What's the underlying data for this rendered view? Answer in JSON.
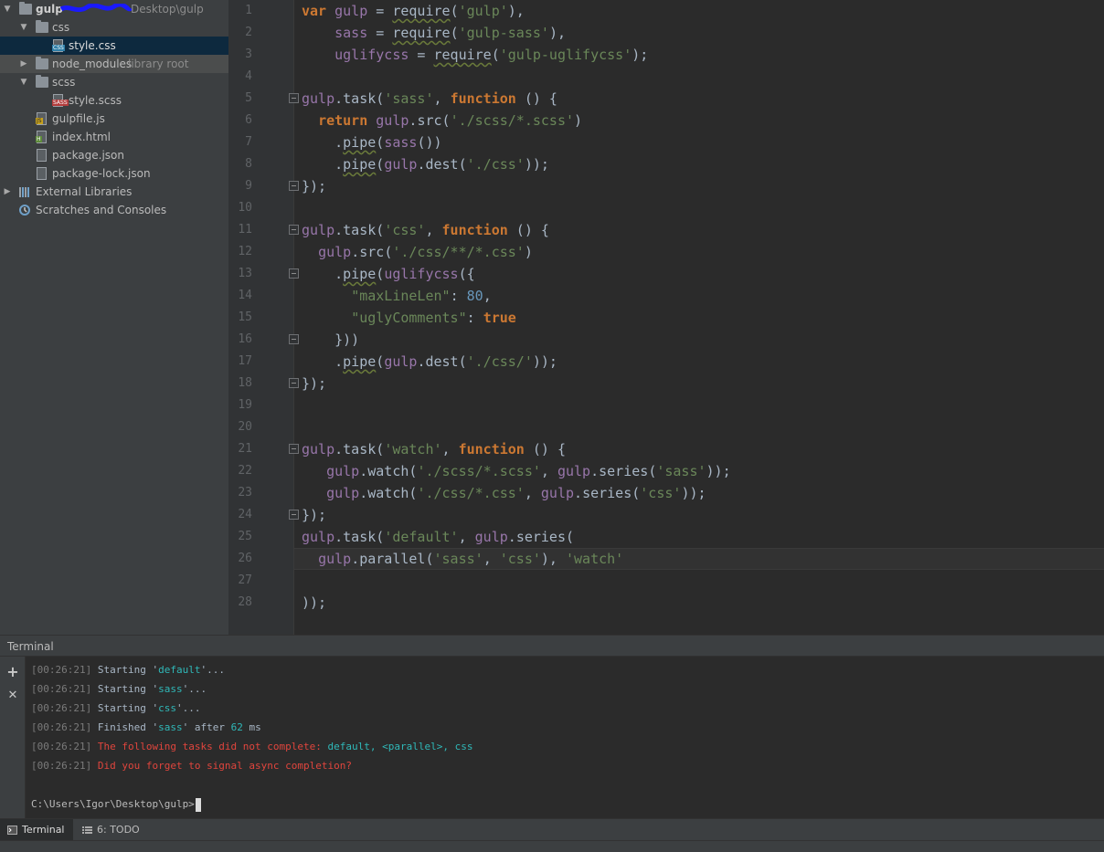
{
  "project_tree": {
    "root": {
      "name": "gulp",
      "path": "Desktop\\gulp"
    },
    "items": [
      {
        "label": "css"
      },
      {
        "label": "style.css"
      },
      {
        "label": "node_modules",
        "suffix": "library root"
      },
      {
        "label": "scss"
      },
      {
        "label": "style.scss"
      },
      {
        "label": "gulpfile.js"
      },
      {
        "label": "index.html"
      },
      {
        "label": "package.json"
      },
      {
        "label": "package-lock.json"
      },
      {
        "label": "External Libraries"
      },
      {
        "label": "Scratches and Consoles"
      }
    ]
  },
  "editor": {
    "line_numbers": [
      "1",
      "2",
      "3",
      "4",
      "5",
      "6",
      "7",
      "8",
      "9",
      "10",
      "11",
      "12",
      "13",
      "14",
      "15",
      "16",
      "17",
      "18",
      "19",
      "20",
      "21",
      "22",
      "23",
      "24",
      "25",
      "26",
      "27",
      "28"
    ],
    "lines": [
      [
        [
          "kw",
          "var "
        ],
        [
          "id",
          "gulp"
        ],
        [
          "pl",
          " = "
        ],
        [
          "fnsq",
          "require"
        ],
        [
          "pl",
          "("
        ],
        [
          "str",
          "'gulp'"
        ],
        [
          "pl",
          "),"
        ]
      ],
      [
        [
          "pl",
          "    "
        ],
        [
          "id",
          "sass"
        ],
        [
          "pl",
          " = "
        ],
        [
          "fnsq",
          "require"
        ],
        [
          "pl",
          "("
        ],
        [
          "str",
          "'gulp-sass'"
        ],
        [
          "pl",
          "),"
        ]
      ],
      [
        [
          "pl",
          "    "
        ],
        [
          "id",
          "uglifycss"
        ],
        [
          "pl",
          " = "
        ],
        [
          "fnsq",
          "require"
        ],
        [
          "pl",
          "("
        ],
        [
          "str",
          "'gulp-uglifycss'"
        ],
        [
          "pl",
          ");"
        ]
      ],
      [],
      [
        [
          "id",
          "gulp"
        ],
        [
          "pl",
          "."
        ],
        [
          "fn",
          "task"
        ],
        [
          "pl",
          "("
        ],
        [
          "str",
          "'sass'"
        ],
        [
          "pl",
          ", "
        ],
        [
          "kw",
          "function"
        ],
        [
          "pl",
          " () {"
        ]
      ],
      [
        [
          "pl",
          "  "
        ],
        [
          "kw",
          "return "
        ],
        [
          "id",
          "gulp"
        ],
        [
          "pl",
          "."
        ],
        [
          "fn",
          "src"
        ],
        [
          "pl",
          "("
        ],
        [
          "str",
          "'./scss/*.scss'"
        ],
        [
          "pl",
          ")"
        ]
      ],
      [
        [
          "pl",
          "    ."
        ],
        [
          "fnsq",
          "pipe"
        ],
        [
          "pl",
          "("
        ],
        [
          "id",
          "sass"
        ],
        [
          "pl",
          "())"
        ]
      ],
      [
        [
          "pl",
          "    ."
        ],
        [
          "fnsq",
          "pipe"
        ],
        [
          "pl",
          "("
        ],
        [
          "id",
          "gulp"
        ],
        [
          "pl",
          "."
        ],
        [
          "fn",
          "dest"
        ],
        [
          "pl",
          "("
        ],
        [
          "str",
          "'./css'"
        ],
        [
          "pl",
          "));"
        ]
      ],
      [
        [
          "pl",
          "});"
        ]
      ],
      [],
      [
        [
          "id",
          "gulp"
        ],
        [
          "pl",
          "."
        ],
        [
          "fn",
          "task"
        ],
        [
          "pl",
          "("
        ],
        [
          "str",
          "'css'"
        ],
        [
          "pl",
          ", "
        ],
        [
          "kw",
          "function"
        ],
        [
          "pl",
          " () {"
        ]
      ],
      [
        [
          "pl",
          "  "
        ],
        [
          "id",
          "gulp"
        ],
        [
          "pl",
          "."
        ],
        [
          "fn",
          "src"
        ],
        [
          "pl",
          "("
        ],
        [
          "str",
          "'./css/**/*.css'"
        ],
        [
          "pl",
          ")"
        ]
      ],
      [
        [
          "pl",
          "    ."
        ],
        [
          "fnsq",
          "pipe"
        ],
        [
          "pl",
          "("
        ],
        [
          "id",
          "uglifycss"
        ],
        [
          "pl",
          "({"
        ]
      ],
      [
        [
          "pl",
          "      "
        ],
        [
          "str",
          "\"maxLineLen\""
        ],
        [
          "pl",
          ": "
        ],
        [
          "num",
          "80"
        ],
        [
          "pl",
          ","
        ]
      ],
      [
        [
          "pl",
          "      "
        ],
        [
          "str",
          "\"uglyComments\""
        ],
        [
          "pl",
          ": "
        ],
        [
          "kw",
          "true"
        ]
      ],
      [
        [
          "pl",
          "    }))"
        ]
      ],
      [
        [
          "pl",
          "    ."
        ],
        [
          "fnsq",
          "pipe"
        ],
        [
          "pl",
          "("
        ],
        [
          "id",
          "gulp"
        ],
        [
          "pl",
          "."
        ],
        [
          "fn",
          "dest"
        ],
        [
          "pl",
          "("
        ],
        [
          "str",
          "'./css/'"
        ],
        [
          "pl",
          "));"
        ]
      ],
      [
        [
          "pl",
          "});"
        ]
      ],
      [],
      [],
      [
        [
          "id",
          "gulp"
        ],
        [
          "pl",
          "."
        ],
        [
          "fn",
          "task"
        ],
        [
          "pl",
          "("
        ],
        [
          "str",
          "'watch'"
        ],
        [
          "pl",
          ", "
        ],
        [
          "kw",
          "function"
        ],
        [
          "pl",
          " () {"
        ]
      ],
      [
        [
          "pl",
          "   "
        ],
        [
          "id",
          "gulp"
        ],
        [
          "pl",
          "."
        ],
        [
          "fn",
          "watch"
        ],
        [
          "pl",
          "("
        ],
        [
          "str",
          "'./scss/*.scss'"
        ],
        [
          "pl",
          ", "
        ],
        [
          "id",
          "gulp"
        ],
        [
          "pl",
          "."
        ],
        [
          "fn",
          "series"
        ],
        [
          "pl",
          "("
        ],
        [
          "str",
          "'sass'"
        ],
        [
          "pl",
          "));"
        ]
      ],
      [
        [
          "pl",
          "   "
        ],
        [
          "id",
          "gulp"
        ],
        [
          "pl",
          "."
        ],
        [
          "fn",
          "watch"
        ],
        [
          "pl",
          "("
        ],
        [
          "str",
          "'./css/*.css'"
        ],
        [
          "pl",
          ", "
        ],
        [
          "id",
          "gulp"
        ],
        [
          "pl",
          "."
        ],
        [
          "fn",
          "series"
        ],
        [
          "pl",
          "("
        ],
        [
          "str",
          "'css'"
        ],
        [
          "pl",
          "));"
        ]
      ],
      [
        [
          "pl",
          "});"
        ]
      ],
      [
        [
          "id",
          "gulp"
        ],
        [
          "pl",
          "."
        ],
        [
          "fn",
          "task"
        ],
        [
          "pl",
          "("
        ],
        [
          "str",
          "'default'"
        ],
        [
          "pl",
          ", "
        ],
        [
          "id",
          "gulp"
        ],
        [
          "pl",
          "."
        ],
        [
          "fn",
          "series"
        ],
        [
          "pl",
          "("
        ]
      ],
      [
        [
          "pl",
          "  "
        ],
        [
          "id",
          "gulp"
        ],
        [
          "pl",
          "."
        ],
        [
          "fn",
          "parallel"
        ],
        [
          "pl",
          "("
        ],
        [
          "str",
          "'sass'"
        ],
        [
          "pl",
          ", "
        ],
        [
          "str",
          "'css'"
        ],
        [
          "pl",
          "), "
        ],
        [
          "str",
          "'watch'"
        ]
      ],
      [],
      [
        [
          "pl",
          "));"
        ]
      ]
    ]
  },
  "terminal": {
    "title": "Terminal",
    "add_label": "+",
    "close_label": "✕",
    "lines": [
      [
        [
          "ts",
          "[00:26:21]"
        ],
        [
          "pl",
          " Starting '"
        ],
        [
          "cy",
          "default"
        ],
        [
          "pl",
          "'..."
        ]
      ],
      [
        [
          "ts",
          "[00:26:21]"
        ],
        [
          "pl",
          " Starting '"
        ],
        [
          "cy",
          "sass"
        ],
        [
          "pl",
          "'..."
        ]
      ],
      [
        [
          "ts",
          "[00:26:21]"
        ],
        [
          "pl",
          " Starting '"
        ],
        [
          "cy",
          "css"
        ],
        [
          "pl",
          "'..."
        ]
      ],
      [
        [
          "ts",
          "[00:26:21]"
        ],
        [
          "pl",
          " Finished '"
        ],
        [
          "cy",
          "sass"
        ],
        [
          "pl",
          "' after "
        ],
        [
          "cy",
          "62"
        ],
        [
          "pl",
          " ms"
        ]
      ],
      [
        [
          "ts",
          "[00:26:21]"
        ],
        [
          "rd",
          " The following tasks did not complete: "
        ],
        [
          "cy",
          "default, <parallel>, css"
        ]
      ],
      [
        [
          "ts",
          "[00:26:21]"
        ],
        [
          "rd",
          " Did you forget to signal async completion?"
        ]
      ]
    ],
    "prompt": "C:\\Users\\Igor\\Desktop\\gulp>"
  },
  "tool_tabs": [
    {
      "label": "Terminal",
      "icon": "terminal-icon"
    },
    {
      "label": "6: TODO",
      "icon": "todo-list-icon"
    }
  ],
  "colors": {
    "keyword": "#cc7832",
    "identifier": "#9876aa",
    "string": "#6a8759",
    "number": "#6897bb",
    "terminal_cyan": "#2fb8b8",
    "terminal_red": "#e0453d"
  }
}
